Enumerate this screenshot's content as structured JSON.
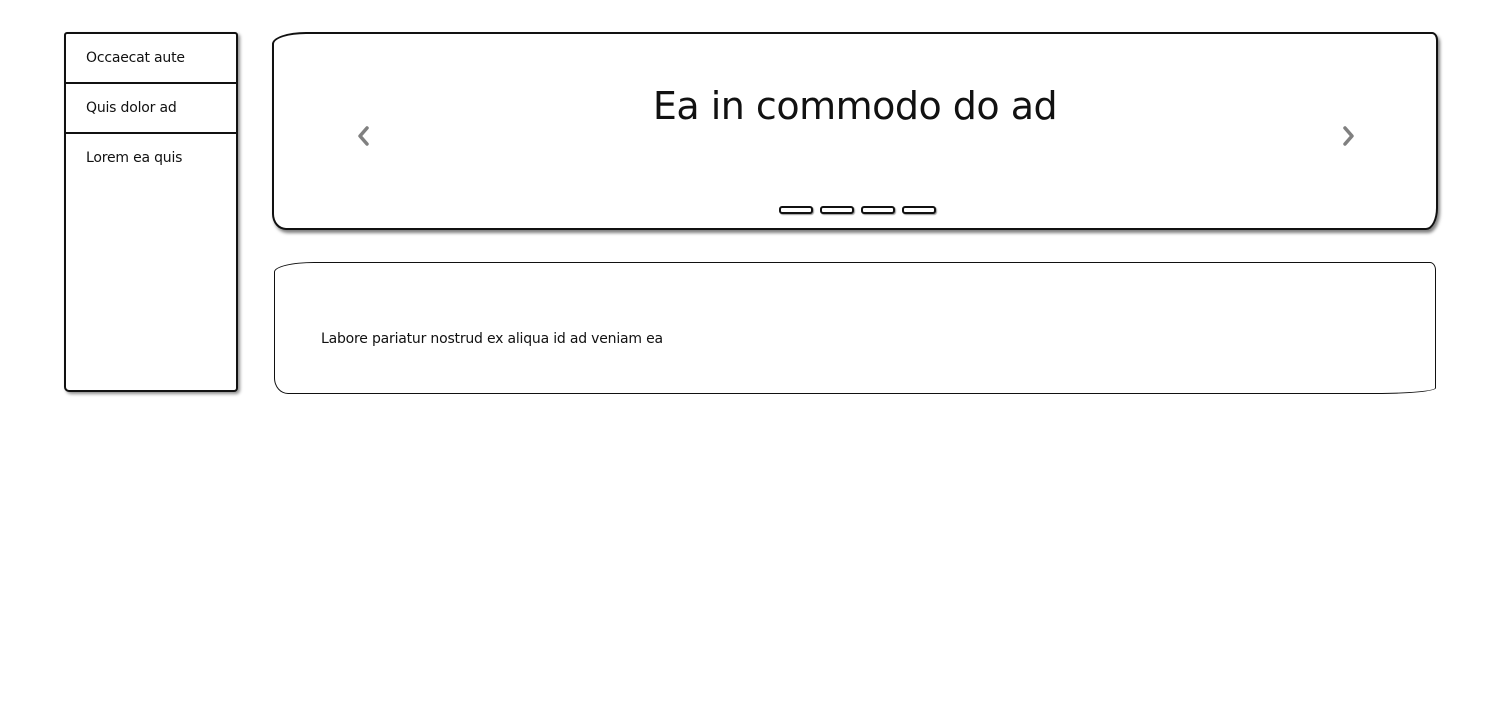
{
  "sidebar": {
    "items": [
      {
        "label": "Occaecat aute"
      },
      {
        "label": "Quis dolor ad"
      },
      {
        "label": "Lorem ea quis"
      }
    ]
  },
  "carousel": {
    "title": "Ea in commodo do ad",
    "prev_icon": "chevron-left-icon",
    "next_icon": "chevron-right-icon",
    "slide_count": 4,
    "arrow_color": "#808080"
  },
  "card": {
    "text": "Labore pariatur nostrud ex aliqua id ad veniam ea"
  }
}
